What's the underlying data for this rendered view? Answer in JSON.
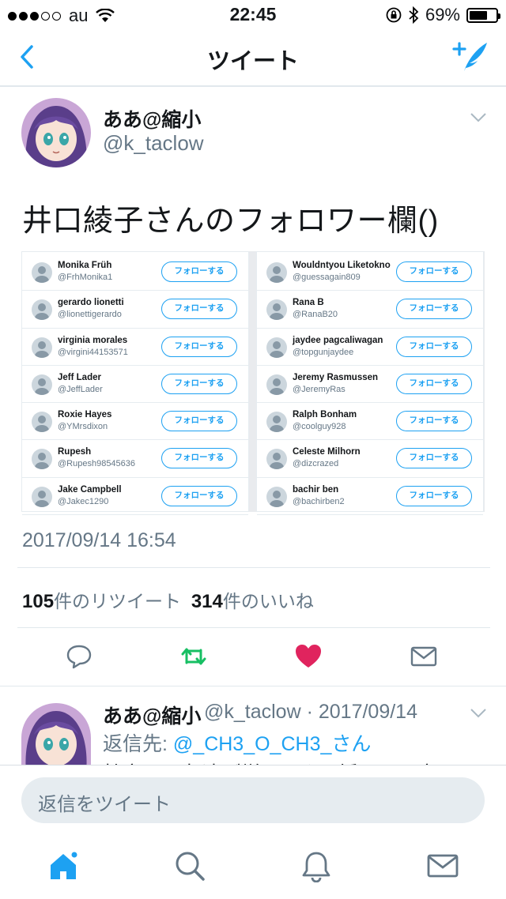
{
  "status_bar": {
    "carrier": "au",
    "time": "22:45",
    "battery": "69%",
    "battery_level": 0.69
  },
  "nav": {
    "title": "ツイート"
  },
  "tweet": {
    "author_name": "ああ@縮小",
    "author_handle": "@k_taclow",
    "text": "井口綾子さんのフォロワー欄()",
    "timestamp": "2017/09/14 16:54",
    "retweet_count": "105",
    "retweet_label": "件のリツイート",
    "like_count": "314",
    "like_label": "件のいいね"
  },
  "media": {
    "follow_label": "フォローする",
    "left": [
      {
        "name": "Monika Früh",
        "handle": "@FrhMonika1"
      },
      {
        "name": "gerardo lionetti",
        "handle": "@lionettigerardo"
      },
      {
        "name": "virginia morales",
        "handle": "@virgini44153571"
      },
      {
        "name": "Jeff Lader",
        "handle": "@JeffLader"
      },
      {
        "name": "Roxie Hayes",
        "handle": "@YMrsdixon"
      },
      {
        "name": "Rupesh",
        "handle": "@Rupesh98545636"
      },
      {
        "name": "Jake Campbell",
        "handle": "@Jakec1290"
      }
    ],
    "right": [
      {
        "name": "Wouldntyou Liketokno",
        "handle": "@guessagain809"
      },
      {
        "name": "Rana B",
        "handle": "@RanaB20"
      },
      {
        "name": "jaydee pagcaliwagan",
        "handle": "@topgunjaydee"
      },
      {
        "name": "Jeremy Rasmussen",
        "handle": "@JeremyRas"
      },
      {
        "name": "Ralph Bonham",
        "handle": "@coolguy928"
      },
      {
        "name": "Celeste Milhorn",
        "handle": "@dizcrazed"
      },
      {
        "name": "bachir ben",
        "handle": "@bachirben2"
      }
    ]
  },
  "reply": {
    "author_name": "ああ@縮小",
    "meta": "@k_taclow · 2017/09/14",
    "reply_to_label": "返信先: ",
    "reply_to_target": "@_CH3_O_CH3_さん",
    "text_partial": "特定層の友達が増ってきた垢だから宝か"
  },
  "composer": {
    "placeholder": "返信をツイート"
  },
  "colors": {
    "accent": "#1da1f2",
    "retweet": "#17bf63",
    "like": "#e0245e",
    "muted": "#657786"
  },
  "icons": [
    "back-icon",
    "compose-icon",
    "caret-down-icon",
    "reply-icon",
    "retweet-icon",
    "like-icon",
    "dm-icon",
    "home-icon",
    "search-icon",
    "notifications-icon",
    "messages-icon"
  ]
}
